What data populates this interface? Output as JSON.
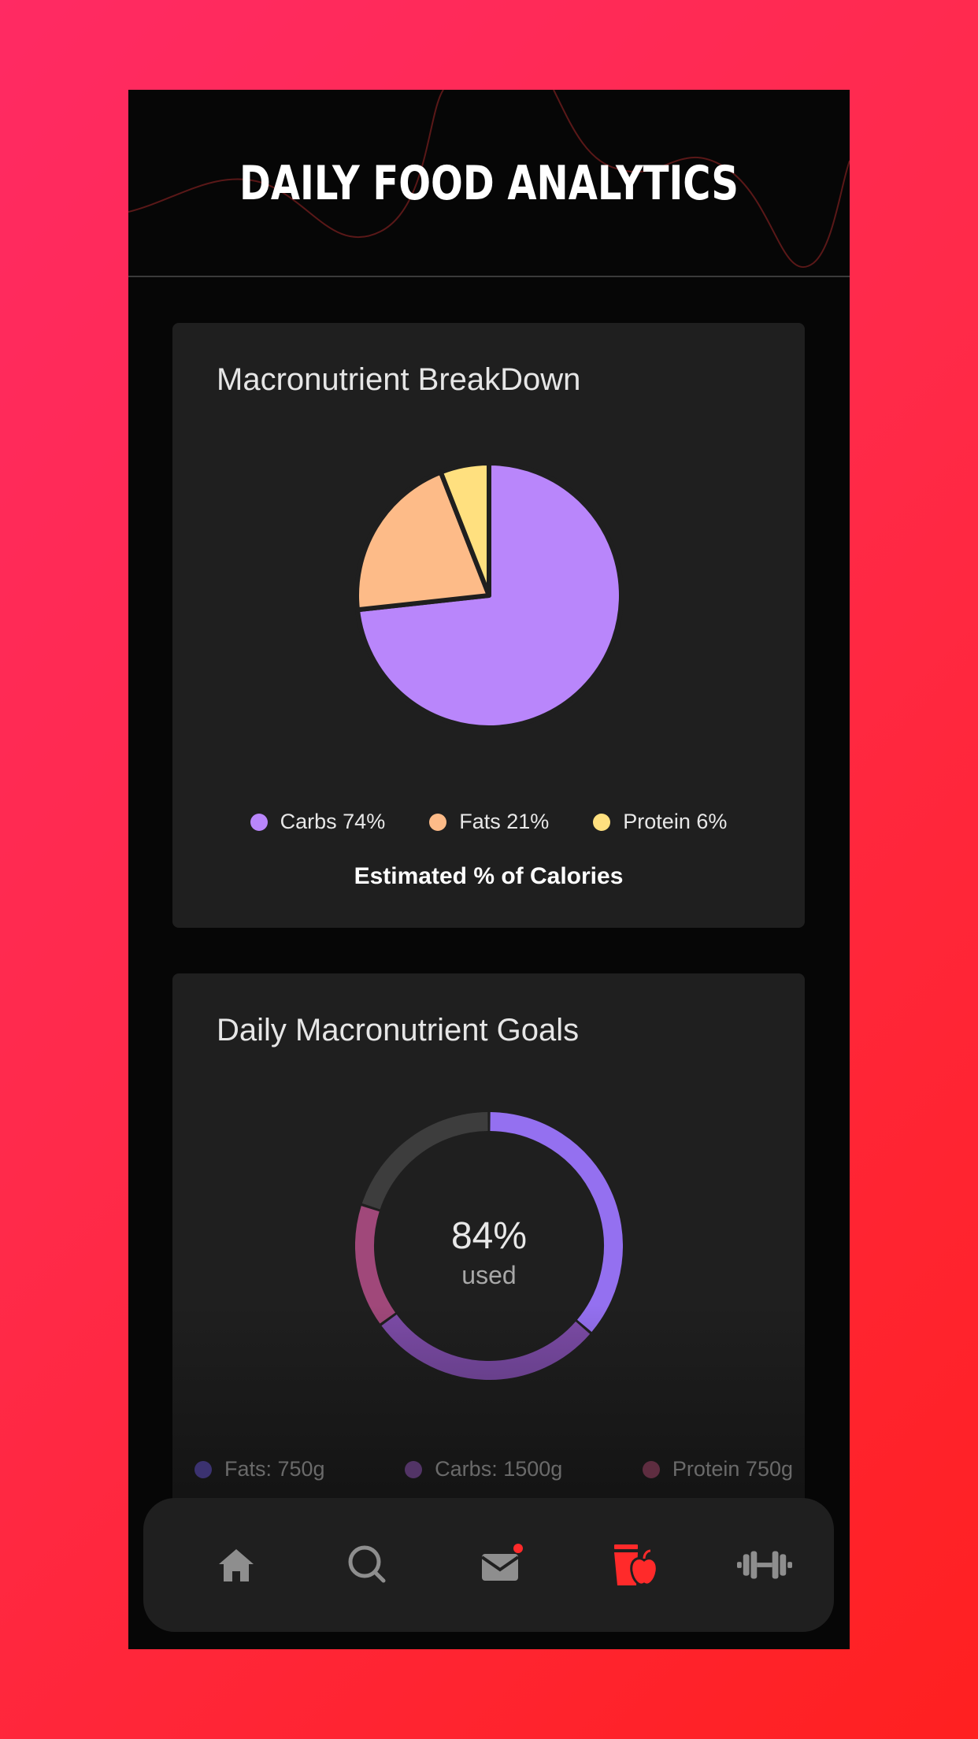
{
  "header": {
    "title": "DAILY FOOD ANALYTICS"
  },
  "breakdown_card": {
    "title": "Macronutrient BreakDown",
    "caption": "Estimated % of Calories",
    "legend": [
      {
        "label": "Carbs 74%",
        "color": "#b986fb"
      },
      {
        "label": "Fats 21%",
        "color": "#fdbb88"
      },
      {
        "label": "Protein 6%",
        "color": "#ffe07f"
      }
    ]
  },
  "goals_card": {
    "title": "Daily Macronutrient Goals",
    "center_value": "84%",
    "center_label": "used",
    "legend": [
      {
        "label": "Fats: 750g",
        "color": "#5b4ba6"
      },
      {
        "label": "Carbs: 1500g",
        "color": "#8a5aa8"
      },
      {
        "label": "Protein 750g",
        "color": "#a85a7a"
      }
    ]
  },
  "nav": {
    "items": [
      {
        "name": "home",
        "icon": "home-icon",
        "active": false
      },
      {
        "name": "search",
        "icon": "search-icon",
        "active": false
      },
      {
        "name": "messages",
        "icon": "mail-icon",
        "active": false,
        "badge": true
      },
      {
        "name": "food",
        "icon": "food-icon",
        "active": true
      },
      {
        "name": "workout",
        "icon": "dumbbell-icon",
        "active": false
      }
    ],
    "active_color": "#ff2a2a",
    "inactive_color": "#8e8e8e"
  },
  "chart_data": [
    {
      "type": "pie",
      "categories": [
        "Carbs",
        "Fats",
        "Protein"
      ],
      "values": [
        74,
        21,
        6
      ],
      "colors": [
        "#b986fb",
        "#fdbb88",
        "#ffe07f"
      ],
      "title": "Macronutrient BreakDown",
      "legend_position": "bottom"
    },
    {
      "type": "donut",
      "categories": [
        "Carbs",
        "Fats",
        "Protein",
        "Remaining"
      ],
      "values": [
        29,
        23,
        12,
        16
      ],
      "used_percent": 84,
      "colors": [
        "#9470f0",
        "#7d4ca8",
        "#a0487a",
        "#3d3d3d"
      ],
      "title": "Daily Macronutrient Goals",
      "legend_position": "bottom"
    }
  ]
}
